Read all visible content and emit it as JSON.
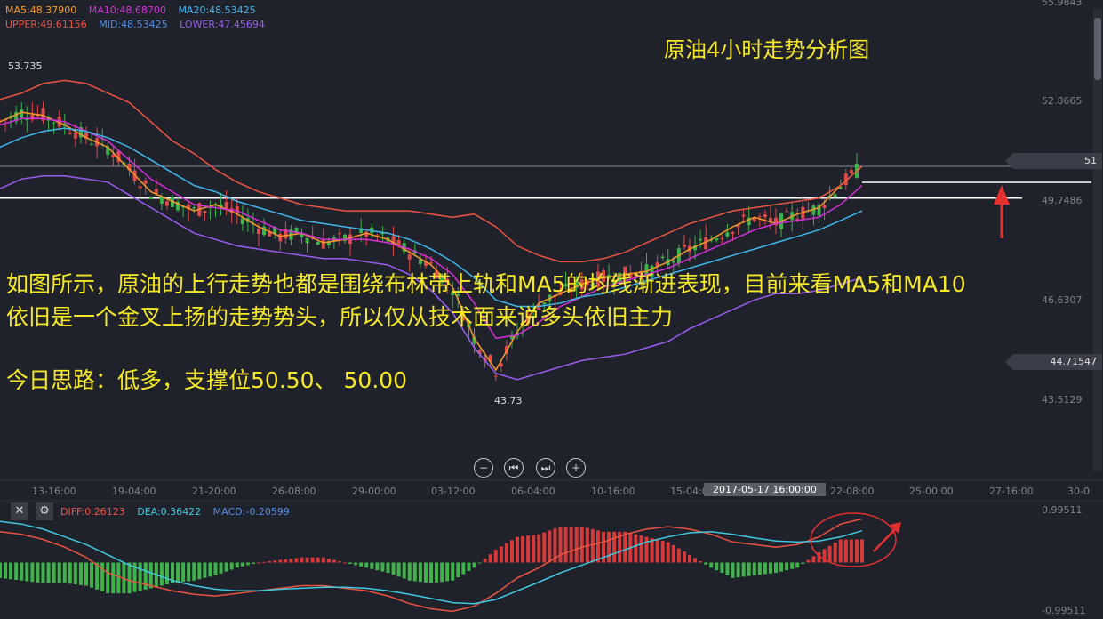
{
  "header": {
    "legend_ma": [
      {
        "label": "MA5:48.37900",
        "color": "#f39a2b"
      },
      {
        "label": "MA10:48.68700",
        "color": "#d42fd8"
      },
      {
        "label": "MA20:48.53425",
        "color": "#3fb6ea"
      }
    ],
    "legend_boll": [
      {
        "label": "UPPER:49.61156",
        "color": "#ec5440"
      },
      {
        "label": "MID:48.53425",
        "color": "#4f8fe8"
      },
      {
        "label": "LOWER:47.45694",
        "color": "#9b5cf0"
      }
    ]
  },
  "annotations": {
    "title": "原油4小时走势分析图",
    "analysis_line1": "如图所示，原油的上行走势也都是围绕布林带上轨和MA5的均线渐进表现，目前来看MA5和MA10",
    "analysis_line2": "依旧是一个金叉上扬的走势势头，所以仅从技术面来说多头依旧主力",
    "strategy": "今日思路：低多，支撑位50.50、 50.00",
    "high_label": "53.735",
    "low_label": "43.73"
  },
  "price_axis": {
    "ticks": [
      "55.9843",
      "52.8665",
      "49.7486",
      "46.6307",
      "43.5129"
    ],
    "current_price_tag": "51",
    "tag_44": "44.71547"
  },
  "time_axis": {
    "ticks": [
      "13-16:00",
      "19-04:00",
      "21-20:00",
      "26-08:00",
      "29-00:00",
      "03-12:00",
      "06-04:00",
      "10-16:00",
      "15-04:00",
      "22-08:00",
      "25-00:00",
      "27-16:00",
      "30-0"
    ],
    "crosshair_time": "2017-05-17 16:00:00"
  },
  "macd_panel": {
    "diff_label": "DIFF:0.26123",
    "dea_label": "DEA:0.36422",
    "macd_label": "MACD:-0.20599",
    "diff_color": "#ec5440",
    "dea_color": "#3fc9e0",
    "macd_color": "#4f8fe8",
    "axis_top": "0.99511",
    "axis_bottom": "-0.99511"
  },
  "colors": {
    "background": "#1f212b",
    "up_candle": "#e04a4a",
    "down_candle": "#3fb34a",
    "annotation_yellow": "#f6e826"
  },
  "chart_data": [
    {
      "type": "candlestick",
      "title": "原油4小时走势分析图",
      "ylim": [
        43.5129,
        55.9843
      ],
      "x_tick_labels": [
        "13-16:00",
        "19-04:00",
        "21-20:00",
        "26-08:00",
        "29-00:00",
        "03-12:00",
        "06-04:00",
        "10-16:00",
        "15-04:00",
        "22-08:00"
      ],
      "series": [
        {
          "name": "MA5",
          "values": [
            52.4,
            52.7,
            52.6,
            52.3,
            51.9,
            51.6,
            50.9,
            50.2,
            49.9,
            49.6,
            49.8,
            49.5,
            49.1,
            48.8,
            48.9,
            48.6,
            48.7,
            48.9,
            48.7,
            48.3,
            47.9,
            47.2,
            45.6,
            44.6,
            45.8,
            46.7,
            47.0,
            47.3,
            47.5,
            47.6,
            47.7,
            48.0,
            48.4,
            48.7,
            49.1,
            49.4,
            49.2,
            49.5,
            49.7,
            50.4,
            51.0
          ]
        },
        {
          "name": "MA10",
          "values": [
            52.3,
            52.5,
            52.5,
            52.4,
            52.1,
            51.8,
            51.2,
            50.6,
            50.2,
            49.8,
            49.7,
            49.6,
            49.3,
            49.0,
            48.9,
            48.7,
            48.7,
            48.7,
            48.6,
            48.4,
            48.1,
            47.6,
            46.7,
            45.6,
            45.7,
            46.1,
            46.6,
            46.9,
            47.2,
            47.4,
            47.6,
            47.8,
            48.1,
            48.4,
            48.7,
            49.0,
            49.2,
            49.3,
            49.4,
            49.8,
            50.4
          ]
        },
        {
          "name": "MA20",
          "values": [
            51.6,
            51.9,
            52.1,
            52.2,
            52.1,
            51.9,
            51.6,
            51.2,
            50.8,
            50.4,
            50.2,
            49.9,
            49.7,
            49.5,
            49.3,
            49.2,
            49.1,
            49.0,
            48.9,
            48.7,
            48.4,
            48.0,
            47.5,
            46.8,
            46.6,
            46.6,
            46.7,
            46.9,
            47.0,
            47.2,
            47.4,
            47.6,
            47.8,
            48.0,
            48.2,
            48.4,
            48.6,
            48.8,
            49.0,
            49.3,
            49.6
          ]
        },
        {
          "name": "UPPER",
          "values": [
            53.1,
            53.3,
            53.6,
            53.7,
            53.6,
            53.3,
            53.0,
            52.4,
            51.8,
            51.4,
            50.9,
            50.5,
            50.2,
            50.0,
            49.8,
            49.7,
            49.6,
            49.6,
            49.6,
            49.6,
            49.5,
            49.4,
            49.5,
            49.1,
            48.5,
            48.2,
            48.0,
            48.0,
            48.1,
            48.3,
            48.6,
            48.9,
            49.2,
            49.4,
            49.6,
            49.7,
            49.8,
            49.9,
            50.0,
            50.4,
            51.0
          ]
        },
        {
          "name": "LOWER",
          "values": [
            50.3,
            50.6,
            50.7,
            50.7,
            50.6,
            50.5,
            50.1,
            49.7,
            49.3,
            48.9,
            48.7,
            48.5,
            48.4,
            48.3,
            48.2,
            48.1,
            48.1,
            48.0,
            47.9,
            47.6,
            47.1,
            46.4,
            45.3,
            44.5,
            44.3,
            44.5,
            44.7,
            44.9,
            45.0,
            45.1,
            45.3,
            45.5,
            45.9,
            46.2,
            46.5,
            46.8,
            47.0,
            47.0,
            47.1,
            47.3,
            47.5
          ]
        }
      ],
      "horizontal_lines": [
        51.0,
        50.0
      ],
      "annotated_high": 53.735,
      "annotated_low": 43.73
    },
    {
      "type": "macd",
      "ylim": [
        -0.99511,
        0.99511
      ],
      "series": [
        {
          "name": "DIFF",
          "values": [
            0.6,
            0.55,
            0.45,
            0.3,
            0.1,
            -0.2,
            -0.35,
            -0.45,
            -0.55,
            -0.62,
            -0.65,
            -0.6,
            -0.55,
            -0.5,
            -0.45,
            -0.45,
            -0.5,
            -0.55,
            -0.65,
            -0.8,
            -0.9,
            -0.95,
            -0.85,
            -0.6,
            -0.3,
            -0.1,
            0.15,
            0.3,
            0.4,
            0.55,
            0.65,
            0.7,
            0.65,
            0.55,
            0.4,
            0.35,
            0.3,
            0.35,
            0.5,
            0.75,
            0.85
          ]
        },
        {
          "name": "DEA",
          "values": [
            0.8,
            0.75,
            0.65,
            0.5,
            0.35,
            0.15,
            -0.05,
            -0.2,
            -0.35,
            -0.45,
            -0.52,
            -0.55,
            -0.55,
            -0.52,
            -0.5,
            -0.48,
            -0.48,
            -0.5,
            -0.55,
            -0.62,
            -0.7,
            -0.78,
            -0.8,
            -0.72,
            -0.55,
            -0.38,
            -0.2,
            -0.05,
            0.1,
            0.25,
            0.4,
            0.5,
            0.58,
            0.6,
            0.55,
            0.48,
            0.42,
            0.4,
            0.42,
            0.5,
            0.62
          ]
        },
        {
          "name": "MACD",
          "values": [
            -0.3,
            -0.35,
            -0.4,
            -0.4,
            -0.45,
            -0.6,
            -0.6,
            -0.5,
            -0.4,
            -0.35,
            -0.25,
            -0.1,
            0.0,
            0.05,
            0.1,
            0.1,
            0.0,
            -0.1,
            -0.2,
            -0.35,
            -0.4,
            -0.35,
            -0.1,
            0.25,
            0.5,
            0.55,
            0.7,
            0.7,
            0.6,
            0.6,
            0.5,
            0.4,
            0.15,
            -0.1,
            -0.3,
            -0.25,
            -0.2,
            -0.1,
            0.2,
            0.45,
            0.45
          ]
        }
      ]
    }
  ]
}
